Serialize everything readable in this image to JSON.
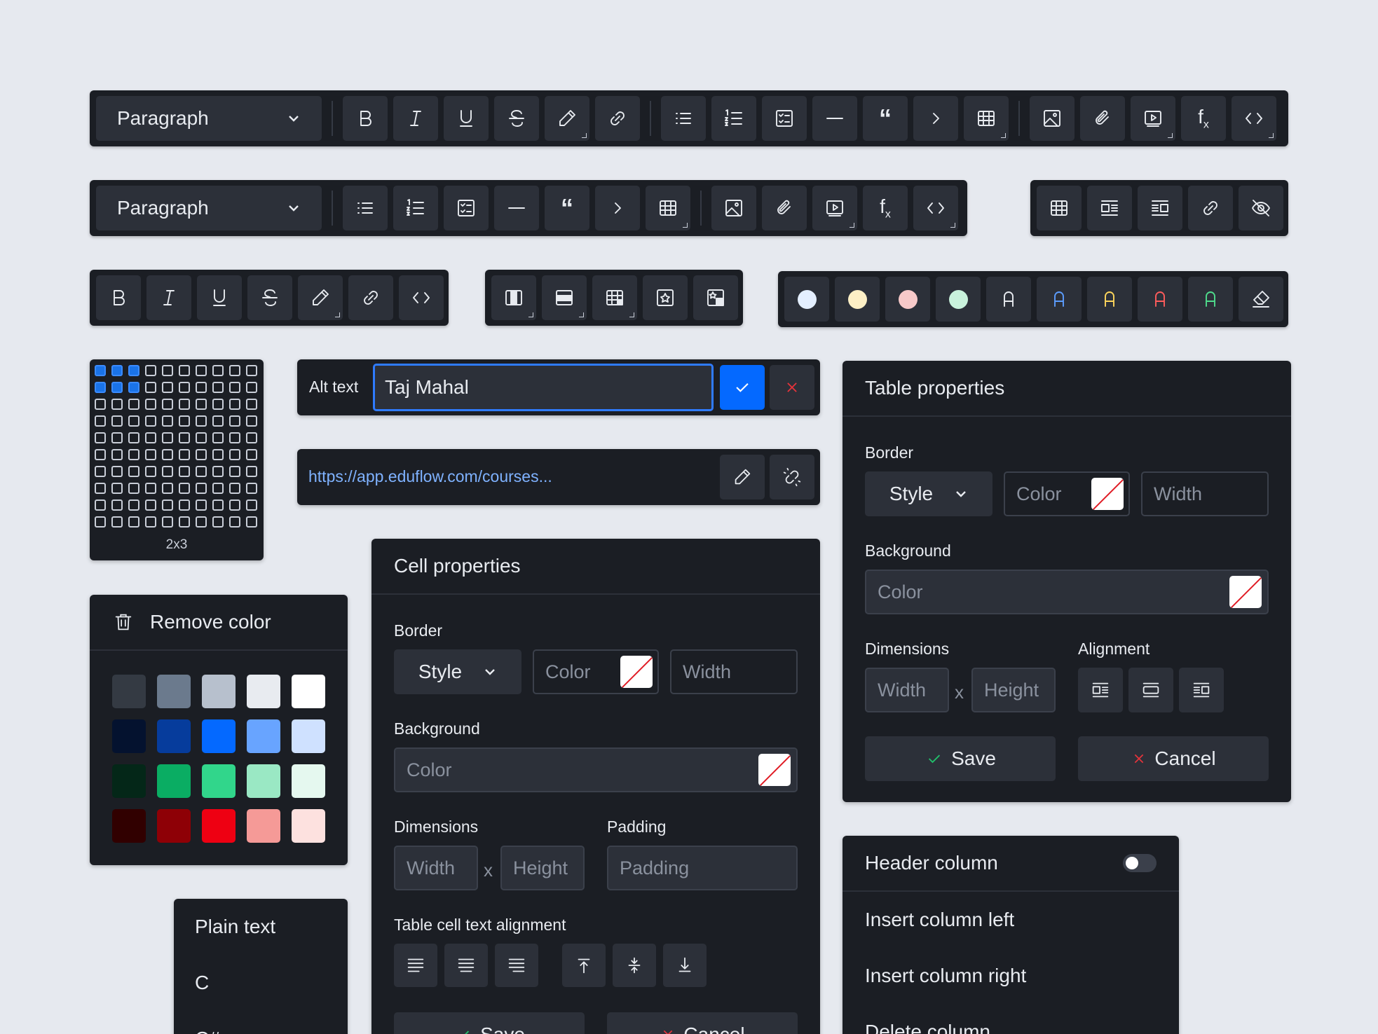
{
  "toolbar1": {
    "paragraph_label": "Paragraph"
  },
  "toolbar2": {
    "paragraph_label": "Paragraph"
  },
  "grid_picker": {
    "size_label": "2x3"
  },
  "alt_text": {
    "label": "Alt text",
    "value": "Taj Mahal"
  },
  "link_bar": {
    "url": "https://app.eduflow.com/courses..."
  },
  "remove_color": {
    "label": "Remove color",
    "colors": [
      [
        "#343a43",
        "#6b7a8d",
        "#b7c0cd",
        "#e8ebf0",
        "#ffffff"
      ],
      [
        "#04122f",
        "#063c9c",
        "#0469ff",
        "#68a4ff",
        "#cfe1ff"
      ],
      [
        "#042718",
        "#0aad63",
        "#31d68b",
        "#9ae8c4",
        "#e5f8ef"
      ],
      [
        "#310000",
        "#8e0006",
        "#ee0012",
        "#f59a97",
        "#fde1df"
      ]
    ]
  },
  "code_lang": {
    "items": [
      "Plain text",
      "C",
      "C#"
    ]
  },
  "cell_properties": {
    "title": "Cell properties",
    "border_label": "Border",
    "style_label": "Style",
    "color_placeholder": "Color",
    "width_placeholder": "Width",
    "background_label": "Background",
    "bg_color_placeholder": "Color",
    "dimensions_label": "Dimensions",
    "dim_width": "Width",
    "dim_x": "x",
    "dim_height": "Height",
    "padding_label": "Padding",
    "padding_placeholder": "Padding",
    "alignment_label": "Table cell text alignment",
    "save_label": "Save",
    "cancel_label": "Cancel"
  },
  "table_properties": {
    "title": "Table properties",
    "border_label": "Border",
    "style_label": "Style",
    "color_placeholder": "Color",
    "width_placeholder": "Width",
    "background_label": "Background",
    "bg_color_placeholder": "Color",
    "dimensions_label": "Dimensions",
    "dim_width": "Width",
    "dim_x": "x",
    "dim_height": "Height",
    "alignment_label": "Alignment",
    "save_label": "Save",
    "cancel_label": "Cancel"
  },
  "column_menu": {
    "header_column": "Header column",
    "items": [
      "Insert column left",
      "Insert column right",
      "Delete column"
    ]
  },
  "text_colors": {
    "highlight_colors": [
      "#e4efff",
      "#fdefc5",
      "#f7c9c9",
      "#c9f2dc"
    ],
    "font_colors": [
      "#e8ebf0",
      "#5c9dff",
      "#ffd65c",
      "#ff5c5c",
      "#4fdc8c"
    ]
  },
  "accent": "#0469ff"
}
